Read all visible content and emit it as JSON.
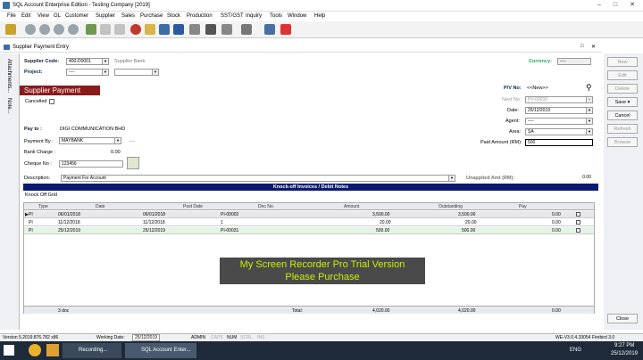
{
  "window": {
    "title": "SQL Account Enterprise Edition - Testing Company [2019]"
  },
  "menu": [
    "File",
    "Edit",
    "View",
    "GL",
    "Customer",
    "Supplier",
    "Sales",
    "Purchase",
    "Stock",
    "Production",
    "SST/GST",
    "Inquiry",
    "Tools",
    "Window",
    "Help"
  ],
  "child": {
    "title": "Supplier Payment Entry"
  },
  "side_tabs": [
    "Attachments...",
    "Note..."
  ],
  "form": {
    "supplier_code_label": "Supplier Code:",
    "supplier_code": "400-D0001",
    "supplier_bank_label": "Supplier Bank:",
    "project_label": "Project:",
    "project": "----",
    "currency_label": "Currency:",
    "currency": "----",
    "banner": "Supplier Payment",
    "cancelled_label": "Cancelled",
    "pv_label": "P/V No:",
    "pv_value": "<<New>>",
    "next_no_label": "Next No:",
    "next_no": "PV-00033",
    "date_label": "Date:",
    "date": "25/12/2019",
    "agent_label": "Agent:",
    "agent": "----",
    "area_label": "Area:",
    "area": "SA",
    "paid_label": "Paid Amount (RM):",
    "paid": "500",
    "pay_to_label": "Pay to :",
    "pay_to": "DIGI COMMUNICATION BHD",
    "payment_by_label": "Payment By :",
    "payment_by": "MAYBANK",
    "payment_by_extra": "----",
    "bank_charge_label": "Bank Charge :",
    "bank_charge": "0.00",
    "cheque_label": "Cheque No :",
    "cheque": "123456",
    "description_label": "Description:",
    "description": "Payment For Account",
    "unapplied_label": "Unapplied Amt (RM):",
    "unapplied": "0.00"
  },
  "knockoff": {
    "header": "Knock-off Invoices / Debit Notes",
    "grid_label": "Knock Off Grid",
    "columns": [
      "Type",
      "Date",
      "Post Date",
      "Doc No.",
      "Amount",
      "Outstanding",
      "Pay"
    ],
    "rows": [
      {
        "type": "PI",
        "date": "06/01/2018",
        "post_date": "06/01/2018",
        "doc_no": "PI-00002",
        "amount": "3,500.00",
        "outstanding": "3,500.00",
        "pay": "0.00"
      },
      {
        "type": "PI",
        "date": "11/12/2018",
        "post_date": "11/12/2018",
        "doc_no": "1",
        "amount": "20.00",
        "outstanding": "20.00",
        "pay": "0.00"
      },
      {
        "type": "PI",
        "date": "25/12/2019",
        "post_date": "25/12/2019",
        "doc_no": "PI-00031",
        "amount": "500.00",
        "outstanding": "500.00",
        "pay": "0.00"
      }
    ],
    "footer": {
      "count": "3 doc",
      "total_label": "Total:",
      "amount": "4,020.00",
      "outstanding": "4,020.00",
      "pay": "0.00"
    }
  },
  "buttons": [
    "New",
    "Edit",
    "Delete",
    "Save",
    "Cancel",
    "Refresh",
    "Browse",
    "Close"
  ],
  "status": {
    "version": "Version 5.2019.876.782 x86",
    "working_date_label": "Working Date:",
    "working_date": "25/12/2019",
    "user": "ADMIN",
    "caps": "CAPS",
    "num": "NUM",
    "scrl": "SCRL",
    "ins": "INS",
    "db": "WE-V3.0.4.33054 Firebird 3.0"
  },
  "taskbar": {
    "recording": "Recording...",
    "app": "SQL Account Enter...",
    "lang": "ENG",
    "time": "9:27 PM",
    "date": "25/12/2019"
  },
  "watermark": {
    "line1": "My Screen Recorder Pro Trial Version",
    "line2": "Please Purchase"
  }
}
